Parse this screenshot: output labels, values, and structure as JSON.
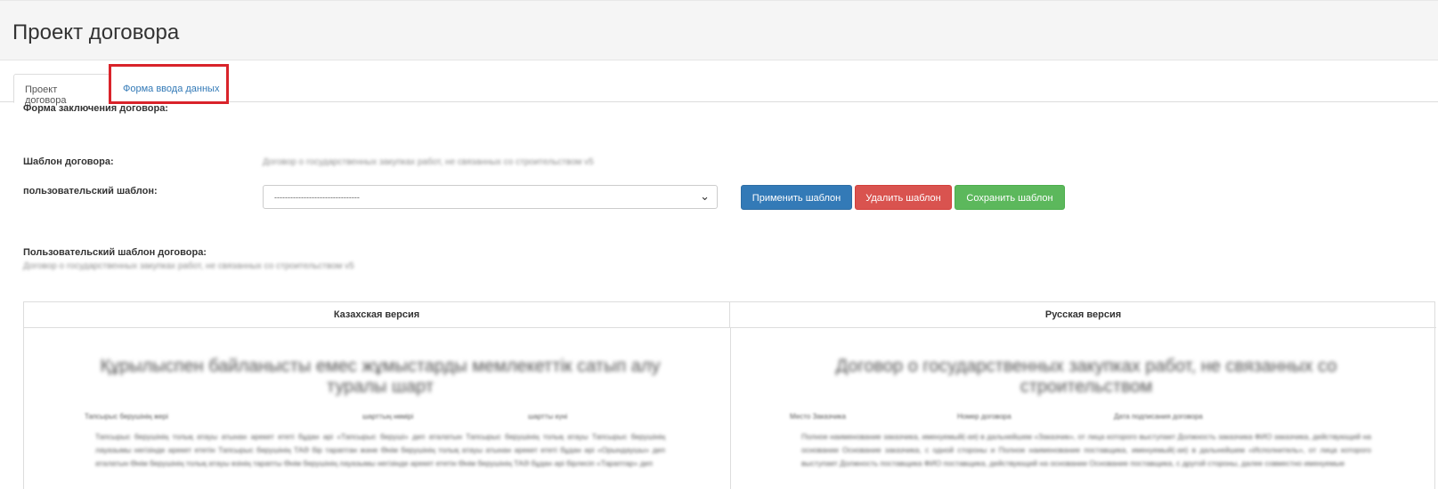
{
  "page": {
    "title": "Проект договора"
  },
  "tabs": [
    {
      "label": "Проект договора",
      "active": true
    },
    {
      "label": "Форма ввода данных",
      "active": false
    }
  ],
  "form": {
    "conclusion_label": "Форма заключения договора:",
    "template_label": "Шаблон договора:",
    "template_value": "Договор о государственных закупках работ, не связанных со строительством v5",
    "user_template_label": "пользовательский шаблон:",
    "user_template_select_value": "--------------------------------",
    "buttons": {
      "apply": "Применить шаблон",
      "delete": "Удалить шаблон",
      "save": "Сохранить шаблон"
    },
    "custom_template_label": "Пользовательский шаблон договора:",
    "custom_template_value": "Договор о государственных закупках работ, не связанных со строительством v5"
  },
  "versions": {
    "kz": {
      "header": "Казахская версия",
      "doc_title": "Құрылыспен байланысты емес жұмыстарды мемлекеттік сатып алу туралы шарт",
      "meta": [
        "Тапсырыс берушінің жері",
        "шарттың нөмірі",
        "шартты күні"
      ],
      "paragraph": "Тапсырыс берушінің толық атауы атынан әрекет ететі бұдан әрі «Тапсырыс берушi» деп аталатын Тапсырыс берушінің толық атауы Тапсырыс берушінің лауазымы негізінде әрекет ететін Тапсырыс берушінің ТАӘ бір тараптан және Өнім берушінің толық атауы атынан әрекет ететі бұдан әрі «Орындаушы» деп аталатын Өнім берушінің толық атауы өзінің тарапты Өнім берушінің лауазымы негізінде әрекет ететін Өнім берушінің ТАӘ бұдан әрі бірлесіп «Тараптар» деп"
    },
    "ru": {
      "header": "Русская версия",
      "doc_title": "Договор о государственных закупках работ, не связанных со строительством",
      "meta": [
        "Место Заказчика",
        "Номер договора",
        "Дата подписания договора"
      ],
      "paragraph": "Полное наименование заказчика, именуемый(-ая) в дальнейшем «Заказчик», от лица которого выступает Должность заказчика ФИО заказчика, действующий на основании Основание заказчика, с одной стороны и Полное наименование поставщика, именуемый(-ая) в дальнейшем «Исполнитель», от лица которого выступает Должность поставщика ФИО поставщика, действующий на основании Основание поставщика, с другой стороны, далее совместно именуемые"
    }
  },
  "colors": {
    "primary": "#337ab7",
    "danger": "#d9534f",
    "success": "#5cb85c",
    "highlight": "#d9232a"
  }
}
